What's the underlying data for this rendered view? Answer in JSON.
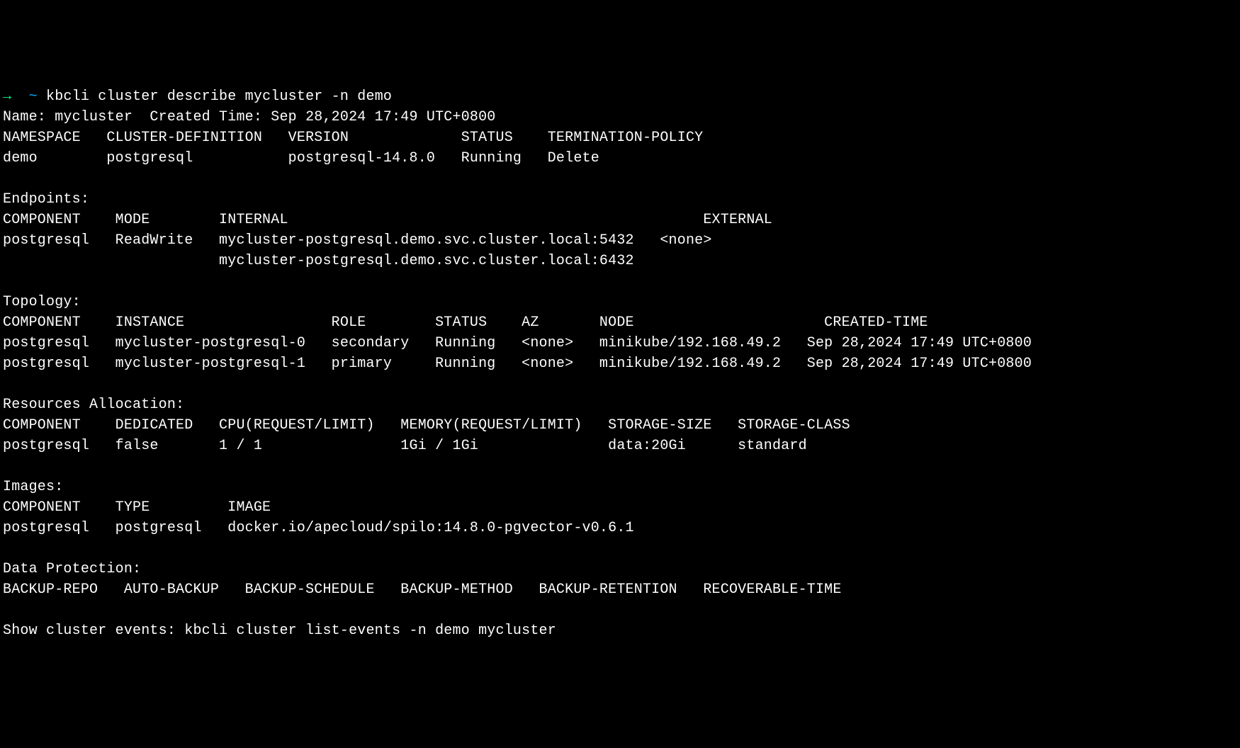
{
  "prompt": {
    "arrow": "→",
    "tilde": "~",
    "command": "kbcli cluster describe mycluster -n demo"
  },
  "header": {
    "line": "Name: mycluster\t Created Time: Sep 28,2024 17:49 UTC+0800"
  },
  "summary": {
    "headers": "NAMESPACE   CLUSTER-DEFINITION   VERSION             STATUS    TERMINATION-POLICY",
    "row": "demo        postgresql           postgresql-14.8.0   Running   Delete"
  },
  "endpoints": {
    "title": "Endpoints:",
    "headers": "COMPONENT    MODE        INTERNAL                                                EXTERNAL",
    "row1": "postgresql   ReadWrite   mycluster-postgresql.demo.svc.cluster.local:5432   <none>",
    "row2": "                         mycluster-postgresql.demo.svc.cluster.local:6432"
  },
  "topology": {
    "title": "Topology:",
    "headers": "COMPONENT    INSTANCE                 ROLE        STATUS    AZ       NODE                      CREATED-TIME",
    "row1": "postgresql   mycluster-postgresql-0   secondary   Running   <none>   minikube/192.168.49.2   Sep 28,2024 17:49 UTC+0800",
    "row2": "postgresql   mycluster-postgresql-1   primary     Running   <none>   minikube/192.168.49.2   Sep 28,2024 17:49 UTC+0800"
  },
  "resources": {
    "title": "Resources Allocation:",
    "headers": "COMPONENT    DEDICATED   CPU(REQUEST/LIMIT)   MEMORY(REQUEST/LIMIT)   STORAGE-SIZE   STORAGE-CLASS",
    "row": "postgresql   false       1 / 1                1Gi / 1Gi               data:20Gi      standard"
  },
  "images": {
    "title": "Images:",
    "headers": "COMPONENT    TYPE         IMAGE",
    "row": "postgresql   postgresql   docker.io/apecloud/spilo:14.8.0-pgvector-v0.6.1"
  },
  "dataprotection": {
    "title": "Data Protection:",
    "headers": "BACKUP-REPO   AUTO-BACKUP   BACKUP-SCHEDULE   BACKUP-METHOD   BACKUP-RETENTION   RECOVERABLE-TIME"
  },
  "footer": {
    "line": "Show cluster events: kbcli cluster list-events -n demo mycluster"
  }
}
